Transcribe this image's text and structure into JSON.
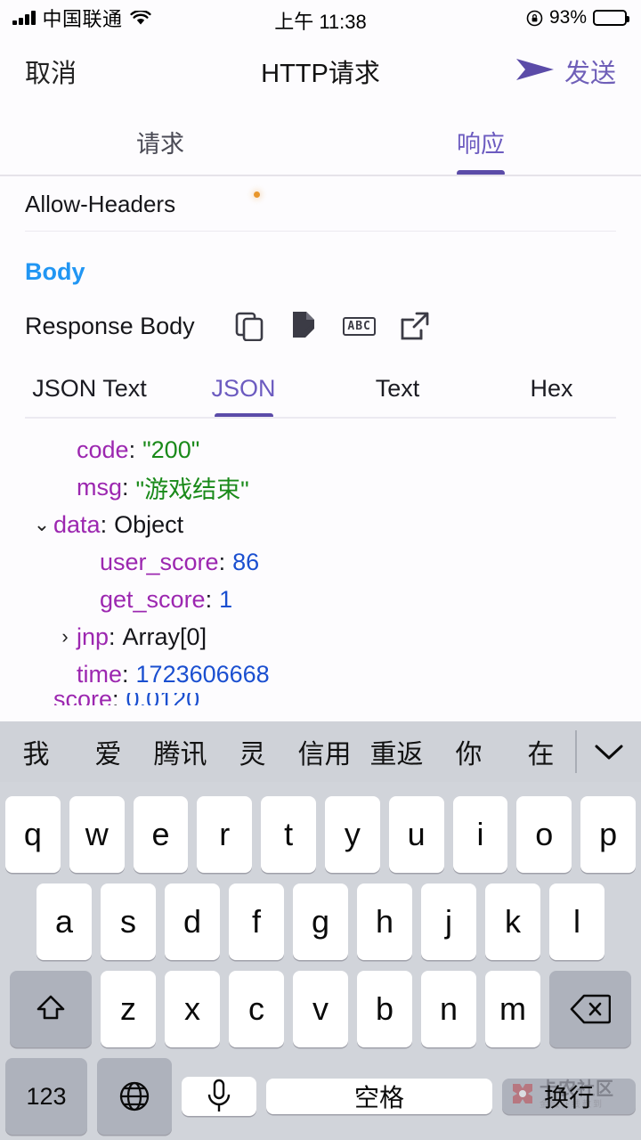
{
  "status_bar": {
    "carrier": "中国联通",
    "time": "上午 11:38",
    "battery_percent": "93%",
    "signal_icon": "signal-bars-icon",
    "wifi_icon": "wifi-icon",
    "rotation_lock_icon": "rotation-lock-icon",
    "battery_icon": "battery-icon"
  },
  "navbar": {
    "cancel_label": "取消",
    "title": "HTTP请求",
    "send_label": "发送",
    "send_icon": "send-arrow-icon",
    "accent_color": "#5b4ba8"
  },
  "segment_tabs": {
    "items": [
      {
        "label": "请求",
        "active": false
      },
      {
        "label": "响应",
        "active": true
      }
    ]
  },
  "headers_remnant": {
    "name": "Allow-Headers",
    "dot_color": "#e8962c"
  },
  "body_section": {
    "section_title": "Body",
    "section_title_color": "#2196f3",
    "row_label": "Response Body",
    "actions": [
      {
        "icon": "copy-icon",
        "label": ""
      },
      {
        "icon": "edit-document-icon",
        "label": ""
      },
      {
        "icon": "abc-text-icon",
        "label": "ABC"
      },
      {
        "icon": "external-link-icon",
        "label": ""
      }
    ]
  },
  "format_tabs": {
    "items": [
      {
        "label": "JSON Text",
        "active": false
      },
      {
        "label": "JSON",
        "active": true
      },
      {
        "label": "Text",
        "active": false
      },
      {
        "label": "Hex",
        "active": false
      }
    ]
  },
  "json_viewer": {
    "rows": [
      {
        "indent": 1,
        "caret": "",
        "key": "code",
        "value": "\"200\"",
        "value_kind": "string"
      },
      {
        "indent": 1,
        "caret": "",
        "key": "msg",
        "value": "\"游戏结束\"",
        "value_kind": "string"
      },
      {
        "indent": 0,
        "caret": "expanded",
        "key": "data",
        "value": "Object",
        "value_kind": "type"
      },
      {
        "indent": 2,
        "caret": "",
        "key": "user_score",
        "value": "86",
        "value_kind": "number"
      },
      {
        "indent": 2,
        "caret": "",
        "key": "get_score",
        "value": "1",
        "value_kind": "number"
      },
      {
        "indent": 1,
        "caret": "collapsed",
        "key": "jnp",
        "value": "Array[0]",
        "value_kind": "type"
      },
      {
        "indent": 1,
        "caret": "",
        "key": "time",
        "value": "1723606668",
        "value_kind": "number"
      }
    ],
    "caret_expanded_glyph": "⌄",
    "caret_collapsed_glyph": "›",
    "key_color": "#9c27b0",
    "string_color": "#1a8a1a",
    "number_color": "#1a4fd0"
  },
  "keyboard": {
    "suggestions": [
      "我",
      "爱",
      "腾讯",
      "灵",
      "信用",
      "重返",
      "你",
      "在"
    ],
    "collapse_icon": "chevron-down-icon",
    "row1": [
      "q",
      "w",
      "e",
      "r",
      "t",
      "y",
      "u",
      "i",
      "o",
      "p"
    ],
    "row2": [
      "a",
      "s",
      "d",
      "f",
      "g",
      "h",
      "j",
      "k",
      "l"
    ],
    "row3": [
      "z",
      "x",
      "c",
      "v",
      "b",
      "n",
      "m"
    ],
    "shift_icon": "shift-icon",
    "backspace_icon": "backspace-icon",
    "numbers_label": "123",
    "globe_icon": "globe-icon",
    "mic_icon": "microphone-icon",
    "space_label": "空格",
    "return_label": "换行",
    "watermark_main": "卡农社区",
    "watermark_sub": "金融在线教到"
  }
}
